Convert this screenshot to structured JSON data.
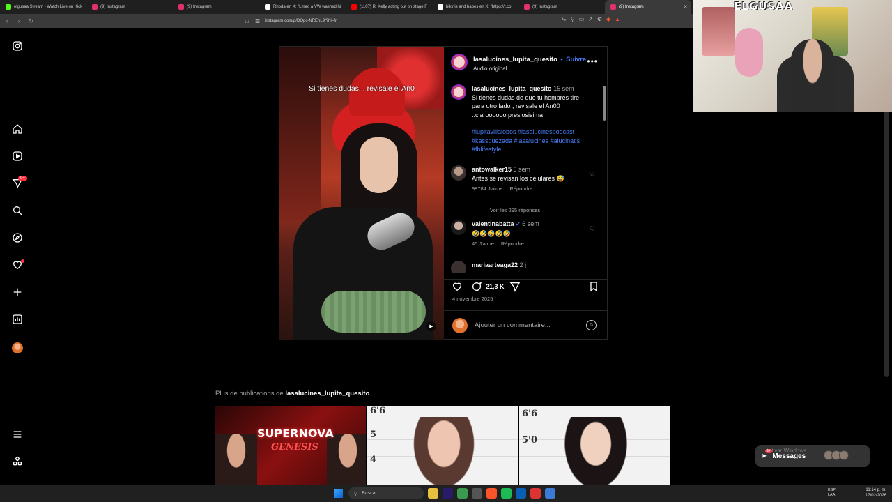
{
  "browser": {
    "tabs": [
      {
        "label": "elgusaa Stream - Watch Live on Kick",
        "color": "#53fc18"
      },
      {
        "label": "(9) Instagram",
        "color": "#e1306c"
      },
      {
        "label": "(9) Instagram",
        "color": "#e1306c"
      },
      {
        "label": "Rhoda en X: \"Lmao a VW washed hi",
        "color": "#ffffff"
      },
      {
        "label": "(1107) R. Kelly acting out on stage F",
        "color": "#ff0000"
      },
      {
        "label": "bikinis and babes en X: \"https://t.co",
        "color": "#ffffff"
      },
      {
        "label": "(9) Instagram",
        "color": "#e1306c"
      },
      {
        "label": "(9) Instagram",
        "color": "#e1306c"
      }
    ],
    "active_tab_close": "×",
    "url": "instagram.com/p/DQpc-NREnL9/?hl=fr"
  },
  "webcam": {
    "logo_text": "ELGUSAA"
  },
  "rail": {
    "notif_badge": "9+"
  },
  "post": {
    "overlay_caption": "Si tienes dudas... revisale el An0",
    "username": "lasalucines_lupita_quesito",
    "follow_sep": "•",
    "follow": "Suivre",
    "audio": "Audio original",
    "caption": {
      "username": "lasalucines_lupita_quesito",
      "time": "15 sem",
      "text": "Si tienes dudas de que tu hombres tire para otro lado , revisale el An00 ..claroooooo presiosisima",
      "hashtags": "#lupitavillalobos #lasalucinespodcast #kassquezada #lasalucines #alucinatis #fblifestyle"
    },
    "comments": [
      {
        "user": "antowalker15",
        "time": "6 sem",
        "text": "Antes se revisan los celulares 😅",
        "likes": "98784 J'aime",
        "reply": "Répondre"
      },
      {
        "user": "valentinabatta",
        "time": "6 sem",
        "text": "🤣🤣🤣🤣🤣",
        "likes": "45 J'aime",
        "reply": "Répondre"
      },
      {
        "user": "mariaarteaga22",
        "time": "2 j",
        "text": "",
        "likes": "",
        "reply": ""
      }
    ],
    "view_replies": "Voir les 295 réponses",
    "comment_count": "21,3 K",
    "date": "4 novembre 2025",
    "add_comment_placeholder": "Ajouter un commentaire..."
  },
  "more": {
    "prefix": "Plus de publications de",
    "username": "lasalucines_lupita_quesito",
    "thumb1_title": "SUPERNOVA",
    "thumb1_sub": "GENESIS",
    "mug_numbers": [
      "6'6",
      "5'0",
      "5",
      "4",
      "6'6",
      "5'0"
    ]
  },
  "notification": {
    "badge": "9+",
    "title": "Messages",
    "watermark": "Activar Windows",
    "more": "···"
  },
  "taskbar": {
    "search_placeholder": "Buscar",
    "lang": "ESP",
    "lang2": "LAA",
    "time": "11:14 p. m.",
    "date": "17/02/2026"
  }
}
